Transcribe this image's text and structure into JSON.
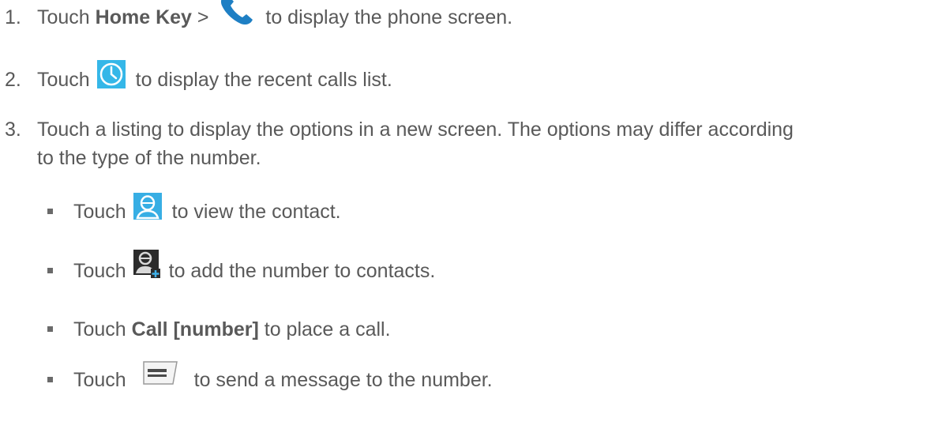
{
  "steps": [
    {
      "number": "1.",
      "pre": "Touch ",
      "bold": "Home Key",
      "mid": " > ",
      "icon": "phone-icon",
      "post": " to display the phone screen."
    },
    {
      "number": "2.",
      "pre": "Touch ",
      "icon": "recent-calls-clock-icon",
      "post": " to display the recent calls list."
    },
    {
      "number": "3.",
      "line1": "Touch a listing to display the options in a new screen. The options may differ according",
      "line2": "to the type of the number."
    }
  ],
  "options": [
    {
      "pre": "Touch ",
      "icon": "view-contact-icon",
      "post": " to view the contact."
    },
    {
      "pre": "Touch ",
      "icon": "add-contact-icon",
      "post": " to add the number to contacts."
    },
    {
      "pre": "Touch ",
      "bold": "Call [number]",
      "post": " to place a call."
    },
    {
      "pre": "Touch ",
      "icon": "message-icon",
      "post": " to send a message to the number."
    }
  ],
  "colors": {
    "text": "#595959",
    "phone_icon": "#1e7fc4",
    "clock_bg": "#35b7e8",
    "contact_bg": "#37aee4",
    "dark_icon": "#2b2b2b"
  }
}
